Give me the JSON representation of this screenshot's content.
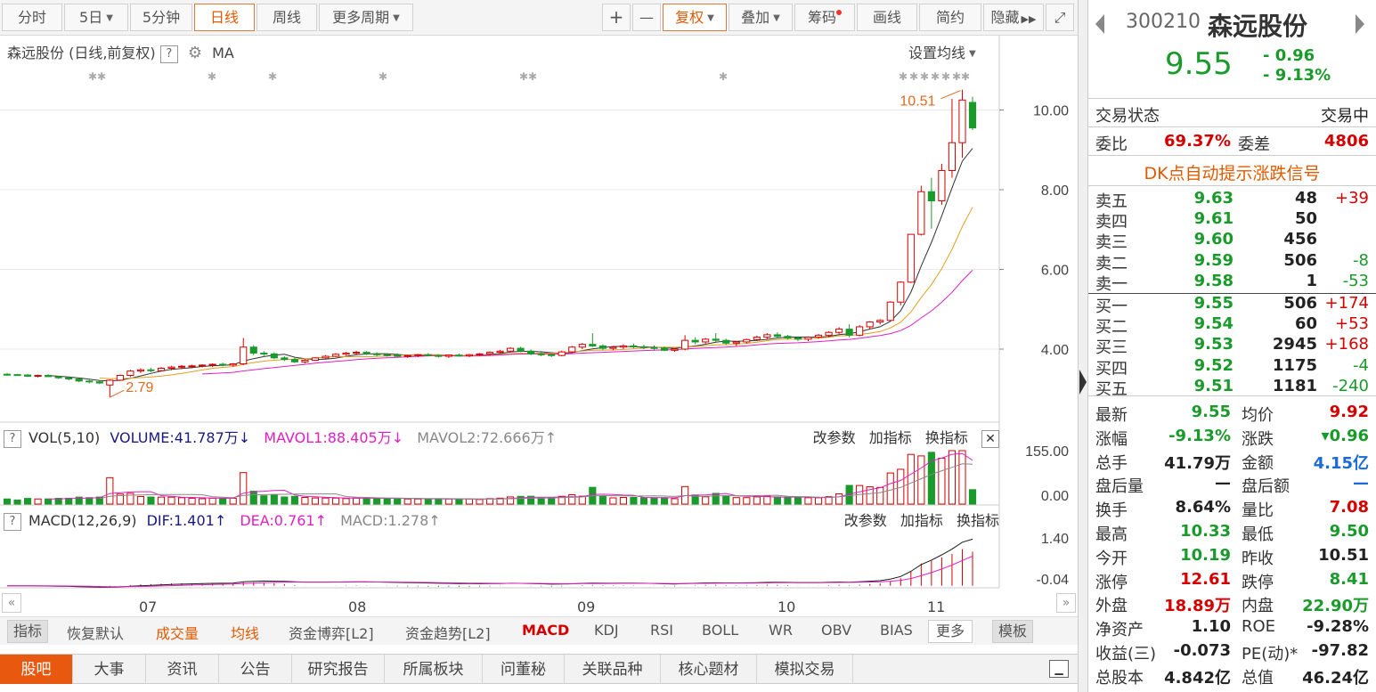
{
  "toolbar": {
    "items": [
      "分时",
      "5日",
      "5分钟",
      "日线",
      "周线",
      "更多周期"
    ],
    "active": "日线",
    "right_items": [
      "+",
      "—",
      "复权",
      "叠加",
      "筹码",
      "画线",
      "简约",
      "隐藏"
    ]
  },
  "chart": {
    "title": "森远股份 (日线,前复权)",
    "help": "?",
    "indicator": "MA",
    "ma_setting": "设置均线",
    "high_label": "10.51",
    "low_label": "2.79",
    "price_axis": [
      "10.00",
      "8.00",
      "6.00",
      "4.00"
    ]
  },
  "chart_data": {
    "type": "candlestick",
    "x_ticks": [
      "07",
      "08",
      "09",
      "10",
      "11"
    ],
    "y_ticks": [
      4.0,
      6.0,
      8.0,
      10.0
    ],
    "annotations": [
      {
        "text": "10.51"
      },
      {
        "text": "2.79"
      }
    ],
    "ohlc": [
      [
        3.37,
        3.4,
        3.33,
        3.36
      ],
      [
        3.36,
        3.38,
        3.33,
        3.35
      ],
      [
        3.35,
        3.38,
        3.3,
        3.32
      ],
      [
        3.32,
        3.36,
        3.29,
        3.34
      ],
      [
        3.34,
        3.37,
        3.3,
        3.31
      ],
      [
        3.31,
        3.33,
        3.25,
        3.28
      ],
      [
        3.28,
        3.3,
        3.22,
        3.25
      ],
      [
        3.25,
        3.27,
        3.17,
        3.2
      ],
      [
        3.2,
        3.23,
        3.14,
        3.18
      ],
      [
        3.18,
        3.22,
        3.12,
        3.15
      ],
      [
        3.1,
        3.24,
        2.79,
        3.22
      ],
      [
        3.22,
        3.36,
        3.2,
        3.34
      ],
      [
        3.34,
        3.48,
        3.3,
        3.45
      ],
      [
        3.45,
        3.52,
        3.4,
        3.48
      ],
      [
        3.48,
        3.53,
        3.42,
        3.46
      ],
      [
        3.46,
        3.55,
        3.44,
        3.52
      ],
      [
        3.52,
        3.58,
        3.47,
        3.55
      ],
      [
        3.55,
        3.6,
        3.5,
        3.57
      ],
      [
        3.57,
        3.61,
        3.52,
        3.58
      ],
      [
        3.58,
        3.62,
        3.54,
        3.6
      ],
      [
        3.6,
        3.64,
        3.55,
        3.62
      ],
      [
        3.62,
        3.66,
        3.57,
        3.6
      ],
      [
        3.6,
        3.65,
        3.56,
        3.63
      ],
      [
        3.63,
        4.28,
        3.6,
        4.05
      ],
      [
        4.05,
        4.1,
        3.85,
        3.9
      ],
      [
        3.9,
        3.95,
        3.8,
        3.88
      ],
      [
        3.88,
        3.92,
        3.75,
        3.78
      ],
      [
        3.78,
        3.82,
        3.7,
        3.74
      ],
      [
        3.74,
        3.78,
        3.65,
        3.68
      ],
      [
        3.68,
        3.75,
        3.64,
        3.72
      ],
      [
        3.72,
        3.8,
        3.7,
        3.78
      ],
      [
        3.78,
        3.85,
        3.75,
        3.82
      ],
      [
        3.82,
        3.9,
        3.8,
        3.87
      ],
      [
        3.87,
        3.93,
        3.84,
        3.9
      ],
      [
        3.9,
        3.96,
        3.86,
        3.92
      ],
      [
        3.92,
        3.95,
        3.85,
        3.88
      ],
      [
        3.88,
        3.92,
        3.82,
        3.86
      ],
      [
        3.86,
        3.9,
        3.81,
        3.85
      ],
      [
        3.85,
        3.89,
        3.8,
        3.82
      ],
      [
        3.82,
        3.86,
        3.78,
        3.84
      ],
      [
        3.84,
        3.88,
        3.8,
        3.86
      ],
      [
        3.86,
        3.9,
        3.82,
        3.84
      ],
      [
        3.84,
        3.87,
        3.79,
        3.82
      ],
      [
        3.82,
        3.86,
        3.78,
        3.85
      ],
      [
        3.85,
        3.89,
        3.81,
        3.83
      ],
      [
        3.83,
        3.88,
        3.8,
        3.86
      ],
      [
        3.86,
        3.9,
        3.83,
        3.88
      ],
      [
        3.88,
        3.94,
        3.85,
        3.92
      ],
      [
        3.92,
        3.98,
        3.88,
        3.95
      ],
      [
        3.95,
        4.05,
        3.92,
        4.02
      ],
      [
        4.02,
        4.06,
        3.92,
        3.95
      ],
      [
        3.95,
        3.99,
        3.85,
        3.88
      ],
      [
        3.88,
        3.92,
        3.82,
        3.86
      ],
      [
        3.86,
        3.9,
        3.8,
        3.84
      ],
      [
        3.84,
        3.96,
        3.82,
        3.93
      ],
      [
        3.93,
        4.08,
        3.9,
        4.05
      ],
      [
        4.05,
        4.15,
        4.0,
        4.12
      ],
      [
        4.12,
        4.4,
        4.05,
        4.08
      ],
      [
        4.08,
        4.12,
        3.98,
        4.02
      ],
      [
        4.02,
        4.08,
        3.97,
        4.05
      ],
      [
        4.05,
        4.12,
        4.0,
        4.08
      ],
      [
        4.08,
        4.14,
        4.02,
        4.06
      ],
      [
        4.06,
        4.11,
        4.0,
        4.04
      ],
      [
        4.04,
        4.09,
        3.98,
        4.02
      ],
      [
        4.02,
        4.06,
        3.95,
        3.97
      ],
      [
        3.97,
        4.02,
        3.93,
        4.0
      ],
      [
        4.0,
        4.35,
        3.97,
        4.22
      ],
      [
        4.22,
        4.3,
        4.12,
        4.18
      ],
      [
        4.18,
        4.28,
        4.14,
        4.25
      ],
      [
        4.25,
        4.4,
        4.18,
        4.22
      ],
      [
        4.22,
        4.26,
        4.1,
        4.15
      ],
      [
        4.15,
        4.2,
        4.08,
        4.18
      ],
      [
        4.18,
        4.26,
        4.14,
        4.24
      ],
      [
        4.24,
        4.34,
        4.2,
        4.3
      ],
      [
        4.3,
        4.4,
        4.24,
        4.36
      ],
      [
        4.36,
        4.42,
        4.28,
        4.32
      ],
      [
        4.32,
        4.36,
        4.24,
        4.28
      ],
      [
        4.28,
        4.32,
        4.2,
        4.25
      ],
      [
        4.25,
        4.32,
        4.2,
        4.3
      ],
      [
        4.3,
        4.38,
        4.26,
        4.35
      ],
      [
        4.35,
        4.45,
        4.3,
        4.42
      ],
      [
        4.42,
        4.55,
        4.38,
        4.5
      ],
      [
        4.5,
        4.62,
        4.3,
        4.35
      ],
      [
        4.35,
        4.6,
        4.32,
        4.56
      ],
      [
        4.56,
        4.7,
        4.5,
        4.68
      ],
      [
        4.68,
        4.75,
        4.62,
        4.72
      ],
      [
        4.72,
        5.2,
        4.7,
        5.18
      ],
      [
        5.18,
        5.7,
        5.1,
        5.68
      ],
      [
        5.68,
        6.88,
        5.66,
        6.88
      ],
      [
        6.88,
        8.1,
        6.85,
        7.95
      ],
      [
        7.95,
        8.3,
        7.02,
        7.72
      ],
      [
        7.72,
        8.65,
        7.62,
        8.48
      ],
      [
        8.48,
        10.28,
        8.3,
        9.18
      ],
      [
        9.18,
        10.51,
        8.8,
        10.25
      ],
      [
        10.19,
        10.33,
        9.5,
        9.55
      ]
    ],
    "ma_series": [
      "MA"
    ]
  },
  "volume": {
    "label": "VOL(5,10)",
    "volume": "VOLUME:41.787万",
    "mavol1": "MAVOL1:88.405万",
    "mavol2": "MAVOL2:72.666万",
    "axis_top": "155.00",
    "axis_bottom": "0.00",
    "buttons": [
      "改参数",
      "加指标",
      "换指标"
    ]
  },
  "macd": {
    "label": "MACD(12,26,9)",
    "dif": "DIF:1.401",
    "dea": "DEA:0.761",
    "macd": "MACD:1.278",
    "axis_top": "1.40",
    "axis_bottom": "-0.04",
    "buttons": [
      "改参数",
      "加指标",
      "换指标"
    ]
  },
  "months": [
    "07",
    "08",
    "09",
    "10",
    "11"
  ],
  "indicator_bar": [
    "指标",
    "恢复默认",
    "成交量",
    "均线",
    "资金博弈[L2]",
    "资金趋势[L2]",
    "MACD",
    "KDJ",
    "RSI",
    "BOLL",
    "WR",
    "OBV",
    "BIAS",
    "更多",
    "模板"
  ],
  "bottom_tabs": [
    "股吧",
    "大事",
    "资讯",
    "公告",
    "研究报告",
    "所属板块",
    "问董秘",
    "关联品种",
    "核心题材",
    "模拟交易"
  ],
  "stock": {
    "code": "300210",
    "name": "森远股份",
    "price": "9.55",
    "change": "- 0.96",
    "change_pct": "- 9.13%"
  },
  "status": {
    "label": "交易状态",
    "value": "交易中"
  },
  "ratio": {
    "label": "委比",
    "value": "69.37%",
    "diff_label": "委差",
    "diff_value": "4806"
  },
  "dk_link": "DK点自动提示涨跌信号",
  "asks": [
    {
      "label": "卖五",
      "price": "9.63",
      "vol": "48",
      "chg": "+39"
    },
    {
      "label": "卖四",
      "price": "9.61",
      "vol": "50",
      "chg": ""
    },
    {
      "label": "卖三",
      "price": "9.60",
      "vol": "456",
      "chg": ""
    },
    {
      "label": "卖二",
      "price": "9.59",
      "vol": "506",
      "chg": "-8"
    },
    {
      "label": "卖一",
      "price": "9.58",
      "vol": "1",
      "chg": "-53"
    }
  ],
  "bids": [
    {
      "label": "买一",
      "price": "9.55",
      "vol": "506",
      "chg": "+174"
    },
    {
      "label": "买二",
      "price": "9.54",
      "vol": "60",
      "chg": "+53"
    },
    {
      "label": "买三",
      "price": "9.53",
      "vol": "2945",
      "chg": "+168"
    },
    {
      "label": "买四",
      "price": "9.52",
      "vol": "1175",
      "chg": "-4"
    },
    {
      "label": "买五",
      "price": "9.51",
      "vol": "1181",
      "chg": "-240"
    }
  ],
  "stats": [
    [
      "最新",
      "9.55",
      "均价",
      "9.92"
    ],
    [
      "涨幅",
      "-9.13%",
      "涨跌",
      "▾0.96"
    ],
    [
      "总手",
      "41.79万",
      "金额",
      "4.15亿"
    ],
    [
      "盘后量",
      "—",
      "盘后额",
      "—"
    ],
    [
      "换手",
      "8.64%",
      "量比",
      "7.08"
    ],
    [
      "最高",
      "10.33",
      "最低",
      "9.50"
    ],
    [
      "今开",
      "10.19",
      "昨收",
      "10.51"
    ],
    [
      "涨停",
      "12.61",
      "跌停",
      "8.41"
    ],
    [
      "外盘",
      "18.89万",
      "内盘",
      "22.90万"
    ],
    [
      "净资产",
      "1.10",
      "ROE",
      "-9.28%"
    ],
    [
      "收益(三)",
      "-0.073",
      "PE(动)*",
      "-97.82"
    ],
    [
      "总股本",
      "4.842亿",
      "总值",
      "46.24亿"
    ]
  ],
  "colors": {
    "up": "#d40000",
    "down": "#1a9a2a",
    "accent": "#e05a00",
    "mavol1": "#e020c0",
    "dea": "#e020c0",
    "dif": "#1a1a1a"
  }
}
